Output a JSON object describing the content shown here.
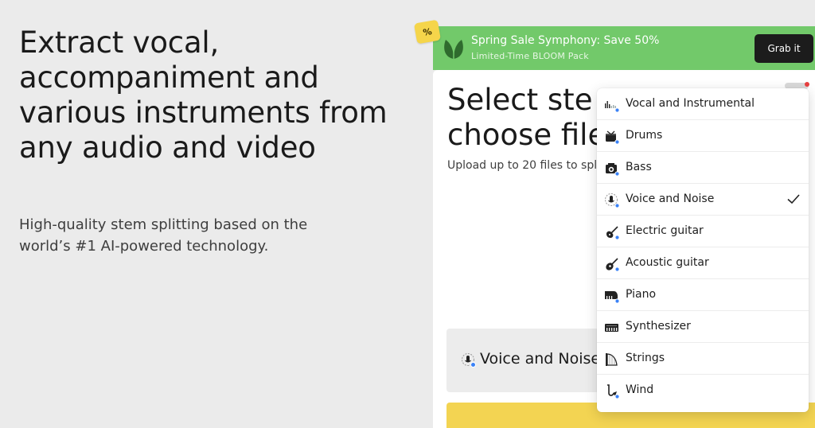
{
  "hero": {
    "title": "Extract vocal, accompaniment and various instruments from any audio and video",
    "subtitle": "High-quality stem splitting based on the world’s #1 AI-powered technology."
  },
  "promo": {
    "title": "Spring Sale Symphony: Save 50%",
    "subtitle": "Limited-Time BLOOM Pack",
    "button": "Grab it",
    "badge": "%",
    "colors": {
      "banner": "#72c96a",
      "button": "#1c1c1c",
      "badge": "#f5d54a"
    }
  },
  "card": {
    "title_line1": "Select ste",
    "title_line2": "choose file",
    "subtitle": "Upload up to 20 files to spli",
    "selected_stem": "Voice and Noise",
    "accent": "#f3d452"
  },
  "dropdown": {
    "items": [
      {
        "label": "Vocal and Instrumental",
        "icon": "vocal-instrumental-icon",
        "selected": false
      },
      {
        "label": "Drums",
        "icon": "drums-icon",
        "selected": false
      },
      {
        "label": "Bass",
        "icon": "bass-icon",
        "selected": false
      },
      {
        "label": "Voice and Noise",
        "icon": "voice-noise-icon",
        "selected": true
      },
      {
        "label": "Electric guitar",
        "icon": "electric-guitar-icon",
        "selected": false
      },
      {
        "label": "Acoustic guitar",
        "icon": "acoustic-guitar-icon",
        "selected": false
      },
      {
        "label": "Piano",
        "icon": "piano-icon",
        "selected": false
      },
      {
        "label": "Synthesizer",
        "icon": "synthesizer-icon",
        "selected": false
      },
      {
        "label": "Strings",
        "icon": "strings-icon",
        "selected": false
      },
      {
        "label": "Wind",
        "icon": "wind-icon",
        "selected": false
      }
    ]
  }
}
